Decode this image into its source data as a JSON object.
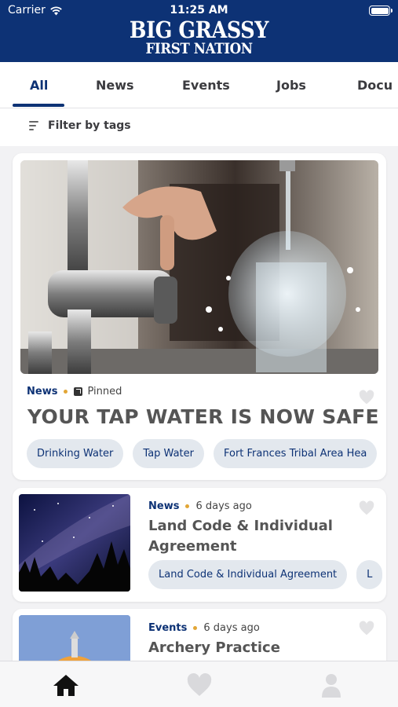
{
  "status_bar": {
    "carrier": "Carrier",
    "time": "11:25 AM"
  },
  "header": {
    "logo_line1": "BIG GRASSY",
    "logo_line2": "FIRST NATION"
  },
  "tabs": [
    {
      "label": "All",
      "active": true
    },
    {
      "label": "News"
    },
    {
      "label": "Events"
    },
    {
      "label": "Jobs"
    },
    {
      "label": "Docu"
    }
  ],
  "filter": {
    "label": "Filter by tags"
  },
  "posts": [
    {
      "category": "News",
      "secondary": "Pinned",
      "title": "YOUR TAP WATER IS NOW SAFE",
      "tags": [
        "Drinking Water",
        "Tap Water",
        "Fort Frances Tribal Area Hea"
      ]
    },
    {
      "category": "News",
      "secondary": "6 days ago",
      "title": "Land Code & Individual Agreement",
      "tags": [
        "Land Code & Individual Agreement",
        "L"
      ]
    },
    {
      "category": "Events",
      "secondary": "6 days ago",
      "title": "Archery Practice"
    }
  ],
  "colors": {
    "brand": "#0d3275",
    "accent_dot": "#e2a636",
    "chip_bg": "#e3e8ee"
  },
  "bottom_nav": [
    {
      "icon": "home-icon",
      "active": true
    },
    {
      "icon": "heart-icon"
    },
    {
      "icon": "profile-icon"
    }
  ]
}
